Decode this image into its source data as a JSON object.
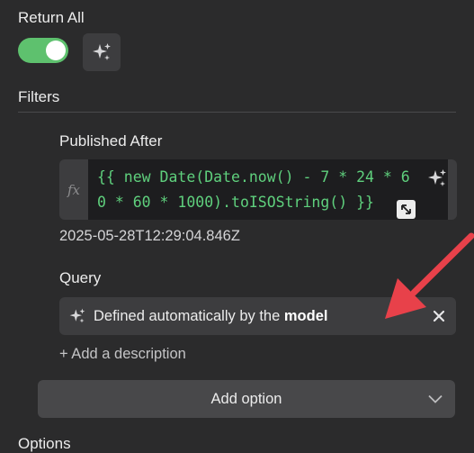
{
  "return_all": {
    "label": "Return All",
    "toggle_on": true,
    "sparkle_icon": "sparkles-icon"
  },
  "filters": {
    "heading": "Filters"
  },
  "published_after": {
    "label": "Published After",
    "fx_label": "fx",
    "expression_line1": "{{ new Date(Date.now() - 7 * 24 * 6",
    "expression_line2": "0 * 60 * 1000).toISOString() }}",
    "result": "2025-05-28T12:29:04.846Z"
  },
  "query": {
    "label": "Query",
    "auto_text_prefix": "Defined automatically by the ",
    "auto_text_bold": "model",
    "add_description": "+ Add a description"
  },
  "add_option": {
    "label": "Add option"
  },
  "options": {
    "heading": "Options"
  },
  "colors": {
    "toggle": "#5ec16e",
    "annotation_arrow": "#e8414a",
    "code_text": "#5fd07d"
  }
}
